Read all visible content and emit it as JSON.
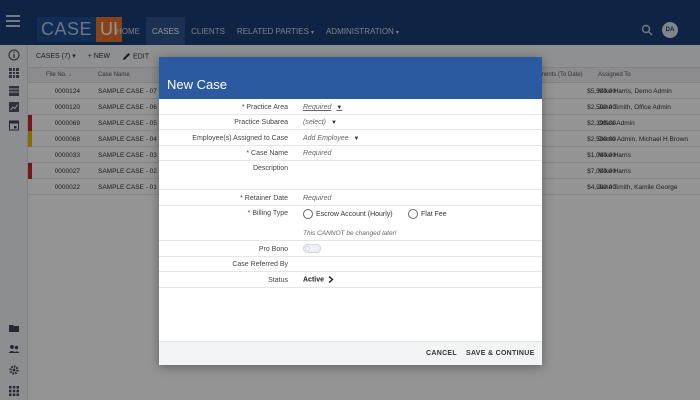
{
  "app": {
    "logo_part1": "CASE",
    "logo_part2": "UI",
    "nav": [
      {
        "label": "HOME",
        "caret": ""
      },
      {
        "label": "CASES",
        "caret": ""
      },
      {
        "label": "CLIENTS",
        "caret": ""
      },
      {
        "label": "RELATED PARTIES",
        "caret": "▾"
      },
      {
        "label": "ADMINISTRATION",
        "caret": "▾"
      }
    ],
    "user_initials": "DA"
  },
  "toolbar": {
    "cases_label": "CASES (7)",
    "cases_caret": "▾",
    "new_label": "+ NEW",
    "edit_label": "EDIT"
  },
  "table": {
    "headers": {
      "file_no": "File No. ↓",
      "case_name": "Case Name",
      "amount": "ments (To Date)",
      "assigned": "Assigned To"
    },
    "rows": [
      {
        "file": "0000124",
        "name": "SAMPLE CASE - 07",
        "amount": "$5,500.00",
        "assigned": "Mike Harris, Demo Admin",
        "flag": ""
      },
      {
        "file": "0000120",
        "name": "SAMPLE CASE - 06",
        "amount": "$2,500.00",
        "assigned": "Jane Smith, Office Admin",
        "flag": ""
      },
      {
        "file": "0000069",
        "name": "SAMPLE CASE - 05",
        "amount": "$2,398.00",
        "assigned": "Office Admin",
        "flag": "#c62828"
      },
      {
        "file": "0000068",
        "name": "SAMPLE CASE - 04",
        "amount": "$2,500.00",
        "assigned": "Demo Admin, Michael H Brown",
        "flag": "#e6b800"
      },
      {
        "file": "0000033",
        "name": "SAMPLE CASE - 03",
        "amount": "$1,060.00",
        "assigned": "Mike Harris",
        "flag": ""
      },
      {
        "file": "0000027",
        "name": "SAMPLE CASE - 02",
        "amount": "$7,000.00",
        "assigned": "Mike Harris",
        "flag": "#c62828"
      },
      {
        "file": "0000022",
        "name": "SAMPLE CASE - 01",
        "amount": "$4,960.00",
        "assigned": "Jane Smith, Kamile George",
        "flag": ""
      }
    ]
  },
  "modal": {
    "title": "New Case",
    "fields": {
      "practice_area": {
        "label": "* Practice Area",
        "value": "Required"
      },
      "practice_subarea": {
        "label": "Practice Subarea",
        "value": "(select)"
      },
      "employees": {
        "label": "Employee(s) Assigned to Case",
        "value": "Add Employee"
      },
      "case_name": {
        "label": "* Case Name",
        "value": "Required"
      },
      "description": {
        "label": "Description",
        "value": ""
      },
      "retainer_date": {
        "label": "* Retainer Date",
        "value": "Required"
      },
      "billing_type": {
        "label": "* Billing Type",
        "option1": "Escrow Account (Hourly)",
        "option2": "Flat Fee",
        "note": "This CANNOT be changed later!"
      },
      "pro_bono": {
        "label": "Pro Bono",
        "value": false
      },
      "referred_by": {
        "label": "Case Referred By",
        "value": ""
      },
      "status": {
        "label": "Status",
        "value": "Active"
      }
    },
    "cancel_label": "CANCEL",
    "save_label": "SAVE & CONTINUE"
  },
  "colors": {
    "topbar": "#1b3f78",
    "modal_header": "#2c5aa0",
    "logo_accent": "#e8742b",
    "flag_red": "#c62828",
    "flag_yellow": "#e6b800"
  }
}
